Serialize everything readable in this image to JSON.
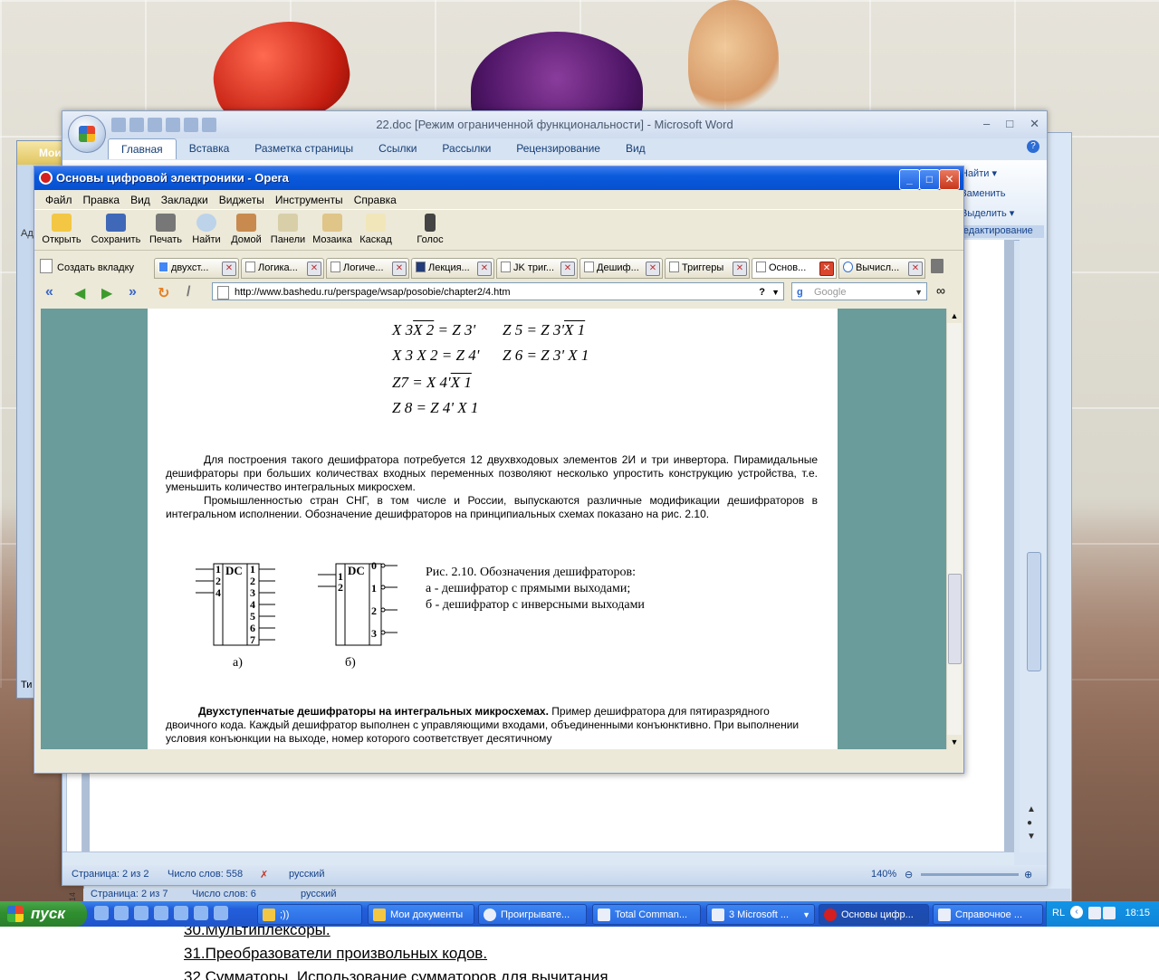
{
  "side_window": {
    "title": "Мои",
    "bottom_label": "Ти",
    "side_label": "Ад"
  },
  "word": {
    "title": "22.doc [Режим ограниченной функциональности] - Microsoft Word",
    "window_controls": [
      "–",
      "□",
      "✕"
    ],
    "tabs": [
      "Главная",
      "Вставка",
      "Разметка страницы",
      "Ссылки",
      "Рассылки",
      "Рецензирование",
      "Вид"
    ],
    "ribbon_right": [
      "Найти ▾",
      "Заменить",
      "Выделить ▾"
    ],
    "ribbon_group": "Редактирование",
    "toc": [
      "30.Мультиплексоры.",
      "31.Преобразователи произвольных кодов.",
      "32.Сумматоры. Использование сумматоров для вычитания."
    ],
    "ruler_number": "14",
    "status": {
      "page": "Страница: 2 из 2",
      "words": "Число слов: 558",
      "lang": "русский",
      "zoom": "140%"
    },
    "second_status": {
      "page": "Страница: 2 из 7",
      "words": "Число слов: 6",
      "lang": "русский"
    }
  },
  "opera": {
    "title": "Основы цифровой электроники - Opera",
    "menu": [
      "Файл",
      "Правка",
      "Вид",
      "Закладки",
      "Виджеты",
      "Инструменты",
      "Справка"
    ],
    "toolbar": [
      "Открыть",
      "Сохранить",
      "Печать",
      "Найти",
      "Домой",
      "Панели",
      "Мозаика",
      "Каскад",
      "Голос"
    ],
    "new_tab": "Создать вкладку",
    "tabs": [
      "двухст...",
      "Логика...",
      "Логиче...",
      "Лекция...",
      "JK триг...",
      "Дешиф...",
      "Триггеры",
      "Основ...",
      "Вычисл..."
    ],
    "address": "http://www.bashedu.ru/perspage/wsap/posobie/chapter2/4.htm",
    "search_placeholder": "Google"
  },
  "page": {
    "equations": [
      {
        "id": "x3x2-z3"
      },
      {
        "id": "z5"
      },
      {
        "id": "x3x2-z4"
      },
      {
        "id": "z6"
      },
      {
        "id": "z7"
      },
      {
        "id": "z8"
      }
    ],
    "para1": "Для построения такого дешифратора потребуется 12 двухвходовых элементов 2И и три инвертора. Пирамидальные дешифраторы при больших количествах входных переменных позволяют несколько упростить конструкцию устройства, т.е. уменьшить количество интегральных микросхем.",
    "para2": "Промышленностью стран СНГ, в том числе и России, выпускаются различные модификации дешифраторов в интегральном исполнении. Обозначение дешифраторов на принципиальных схемах показано на рис. 2.10.",
    "figure_caption_1": "Рис. 2.10. Обозначения дешифраторов:",
    "figure_caption_2": "а -  дешифратор с прямыми выходами;",
    "figure_caption_3": "б - дешифратор с инверсными выходами",
    "figure_label_a": "а)",
    "figure_label_b": "б)",
    "dc_label": "DC",
    "dc_a_inputs": [
      "1",
      "2",
      "4"
    ],
    "dc_a_outputs": [
      "1",
      "2",
      "3",
      "4",
      "5",
      "6",
      "7"
    ],
    "dc_b_inputs": [
      "1",
      "2"
    ],
    "dc_b_outputs": [
      "0",
      "1",
      "2",
      "3"
    ],
    "bottom_bold": "Двухступенчатые дешифраторы на интегральных микросхемах.",
    "bottom_text": " Пример дешифратора для пятиразрядного двоичного кода. Каждый дешифратор выполнен с управляющими входами, объединенными конъюнктивно. При выполнении условия конъюнкции на выходе, номер которого соответствует десятичному"
  },
  "taskbar": {
    "start": "пуск",
    "quick_label": ";))",
    "items": [
      "Мои документы",
      "Проигрывате...",
      "Total Comman...",
      "3 Microsoft ...",
      "Основы цифр...",
      "Справочное ..."
    ],
    "lang": "RL",
    "clock": "18:15"
  }
}
